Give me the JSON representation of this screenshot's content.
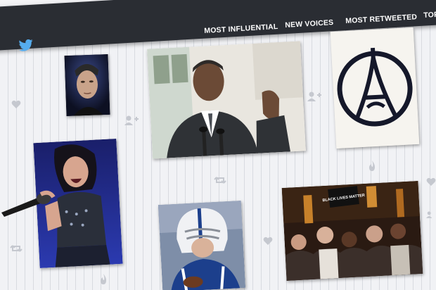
{
  "brand": {
    "logo_icon": "bird-icon",
    "color": "#55acee"
  },
  "nav": {
    "items": [
      {
        "label": "Most Influential"
      },
      {
        "label": "New Voices"
      },
      {
        "label": "Most Retweeted"
      },
      {
        "label": "Top"
      }
    ]
  },
  "colors": {
    "navbar": "#2a2d33",
    "background": "#f1f2f5",
    "icon": "#c5c8cf"
  },
  "photos": {
    "protest_sign_text": "BLACK LIVES MATTER"
  },
  "icons": [
    "heart-icon",
    "add-user-icon",
    "retweet-icon",
    "flame-icon"
  ]
}
